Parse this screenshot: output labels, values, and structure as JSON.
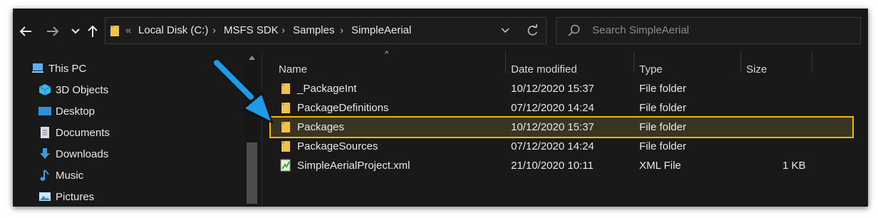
{
  "nav": {
    "back_icon": "arrow-left-icon",
    "forward_icon": "arrow-right-icon",
    "recent_icon": "chevron-down-icon",
    "up_icon": "arrow-up-icon"
  },
  "address": {
    "overflow": "«",
    "crumbs": [
      "Local Disk (C:)",
      "MSFS SDK",
      "Samples",
      "SimpleAerial"
    ],
    "separator": "›"
  },
  "search": {
    "placeholder": "Search SimpleAerial"
  },
  "sidebar": {
    "items": [
      {
        "label": "This PC",
        "icon": "this-pc-icon"
      },
      {
        "label": "3D Objects",
        "icon": "3d-objects-icon"
      },
      {
        "label": "Desktop",
        "icon": "desktop-icon"
      },
      {
        "label": "Documents",
        "icon": "documents-icon"
      },
      {
        "label": "Downloads",
        "icon": "downloads-icon"
      },
      {
        "label": "Music",
        "icon": "music-icon"
      },
      {
        "label": "Pictures",
        "icon": "pictures-icon"
      }
    ]
  },
  "columns": {
    "name": "Name",
    "date": "Date modified",
    "type": "Type",
    "size": "Size"
  },
  "files": [
    {
      "name": "_PackageInt",
      "date": "10/12/2020 15:37",
      "type": "File folder",
      "size": ""
    },
    {
      "name": "PackageDefinitions",
      "date": "07/12/2020 14:24",
      "type": "File folder",
      "size": ""
    },
    {
      "name": "Packages",
      "date": "10/12/2020 15:37",
      "type": "File folder",
      "size": ""
    },
    {
      "name": "PackageSources",
      "date": "07/12/2020 14:24",
      "type": "File folder",
      "size": ""
    },
    {
      "name": "SimpleAerialProject.xml",
      "date": "21/10/2020 10:11",
      "type": "XML File",
      "size": "1 KB"
    }
  ],
  "colors": {
    "window_bg": "#191919",
    "highlight_border": "#f5b800",
    "callout_arrow": "#1e9be8",
    "folder": "#f0c24b"
  }
}
